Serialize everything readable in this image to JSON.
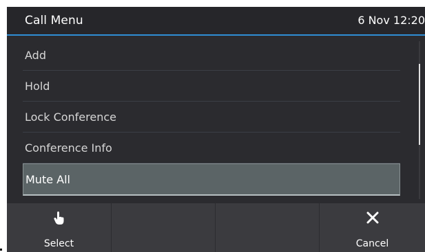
{
  "header": {
    "title": "Call Menu",
    "datetime": "6 Nov 12:20"
  },
  "menu": {
    "items": [
      {
        "label": "Add"
      },
      {
        "label": "Hold"
      },
      {
        "label": "Lock Conference"
      },
      {
        "label": "Conference Info"
      },
      {
        "label": "Mute All"
      }
    ],
    "selected_label": "Mute All"
  },
  "softkeys": [
    {
      "label": "Select",
      "icon": "hand-pointer-icon"
    },
    {
      "label": ""
    },
    {
      "label": ""
    },
    {
      "label": "Cancel",
      "icon": "close-icon"
    }
  ],
  "colors": {
    "accent": "#2f8fd6",
    "background": "#2b2b2f",
    "selected": "#5b6466"
  }
}
